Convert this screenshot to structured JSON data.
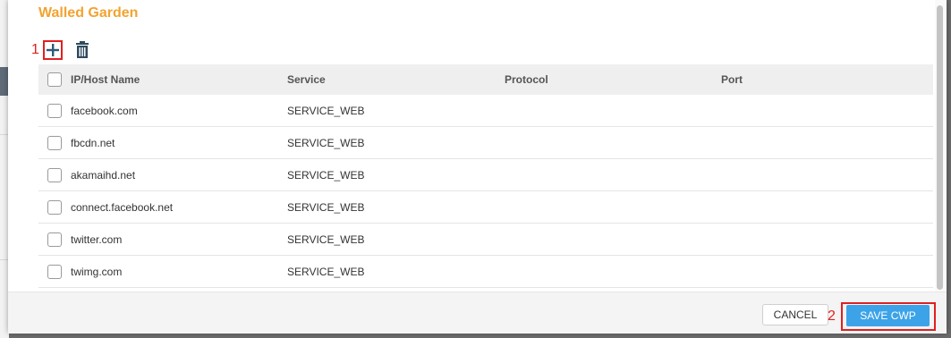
{
  "dialog": {
    "title": "Walled Garden"
  },
  "annotations": {
    "first": "1",
    "second": "2",
    "color": "#e02020"
  },
  "toolbar": {
    "add_icon": "plus-icon",
    "delete_icon": "trash-icon"
  },
  "table": {
    "columns": [
      "IP/Host Name",
      "Service",
      "Protocol",
      "Port"
    ],
    "rows": [
      {
        "host": "facebook.com",
        "service": "SERVICE_WEB",
        "protocol": "",
        "port": ""
      },
      {
        "host": "fbcdn.net",
        "service": "SERVICE_WEB",
        "protocol": "",
        "port": ""
      },
      {
        "host": "akamaihd.net",
        "service": "SERVICE_WEB",
        "protocol": "",
        "port": ""
      },
      {
        "host": "connect.facebook.net",
        "service": "SERVICE_WEB",
        "protocol": "",
        "port": ""
      },
      {
        "host": "twitter.com",
        "service": "SERVICE_WEB",
        "protocol": "",
        "port": ""
      },
      {
        "host": "twimg.com",
        "service": "SERVICE_WEB",
        "protocol": "",
        "port": ""
      }
    ]
  },
  "footer": {
    "cancel_label": "CANCEL",
    "save_label": "SAVE CWP"
  },
  "colors": {
    "title": "#f2a330",
    "primary_button": "#3da3e8"
  }
}
